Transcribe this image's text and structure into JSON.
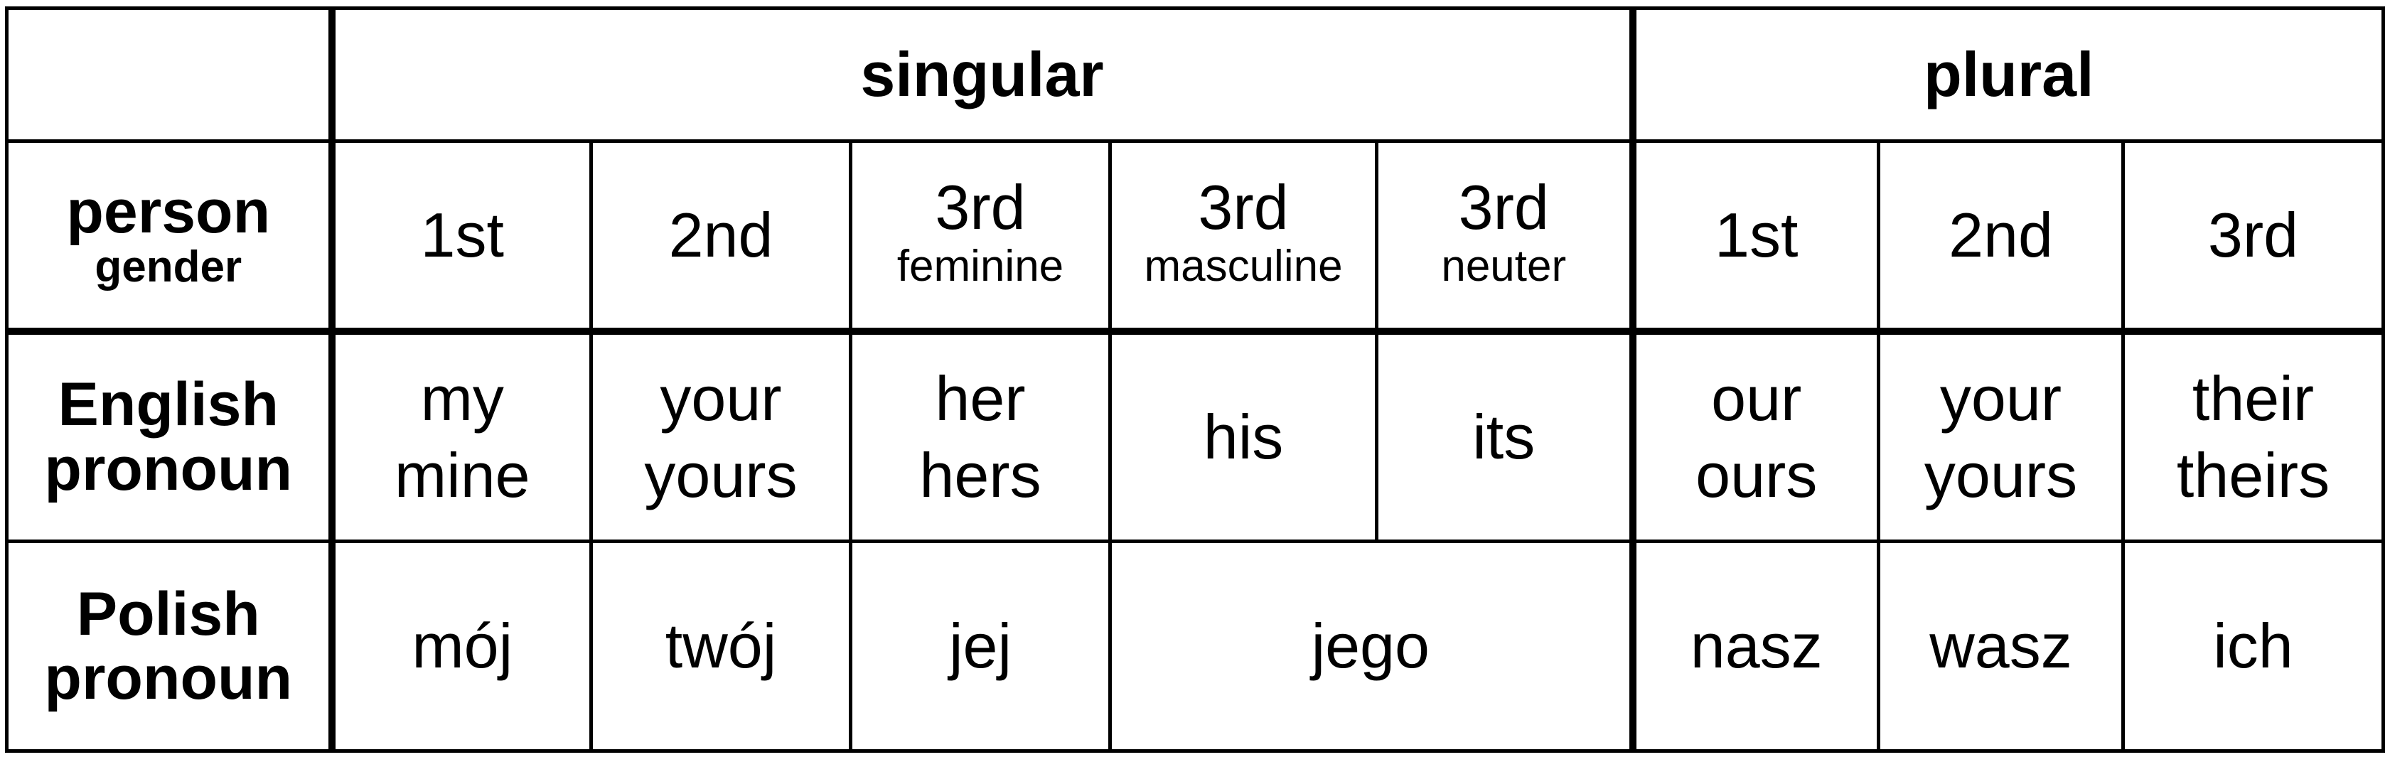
{
  "table": {
    "group_headers": {
      "corner": "",
      "singular": "singular",
      "plural": "plural"
    },
    "header_row": {
      "label_main": "person",
      "label_sub": "gender",
      "columns": [
        {
          "person": "1st",
          "gender": ""
        },
        {
          "person": "2nd",
          "gender": ""
        },
        {
          "person": "3rd",
          "gender": "feminine"
        },
        {
          "person": "3rd",
          "gender": "masculine"
        },
        {
          "person": "3rd",
          "gender": "neuter"
        },
        {
          "person": "1st",
          "gender": ""
        },
        {
          "person": "2nd",
          "gender": ""
        },
        {
          "person": "3rd",
          "gender": ""
        }
      ]
    },
    "english_row": {
      "label_line1": "English",
      "label_line2": "pronoun",
      "cells": [
        {
          "line1": "my",
          "line2": "mine"
        },
        {
          "line1": "your",
          "line2": "yours"
        },
        {
          "line1": "her",
          "line2": "hers"
        },
        {
          "line1": "his",
          "line2": ""
        },
        {
          "line1": "its",
          "line2": ""
        },
        {
          "line1": "our",
          "line2": "ours"
        },
        {
          "line1": "your",
          "line2": "yours"
        },
        {
          "line1": "their",
          "line2": "theirs"
        }
      ]
    },
    "polish_row": {
      "label_line1": "Polish",
      "label_line2": "pronoun",
      "cells": [
        {
          "value": "mój",
          "span": 1
        },
        {
          "value": "twój",
          "span": 1
        },
        {
          "value": "jej",
          "span": 1
        },
        {
          "value": "jego",
          "span": 2
        },
        {
          "value": "nasz",
          "span": 1
        },
        {
          "value": "wasz",
          "span": 1
        },
        {
          "value": "ich",
          "span": 1
        }
      ]
    }
  }
}
